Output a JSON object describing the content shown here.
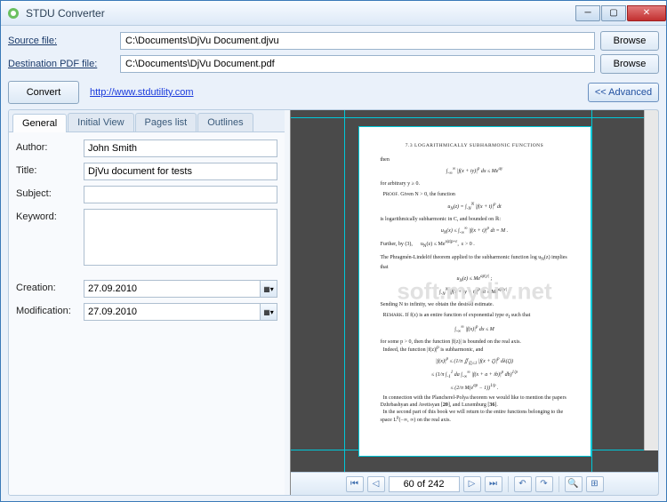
{
  "window": {
    "title": "STDU Converter"
  },
  "files": {
    "source_label": "Source file:",
    "source_value": "C:\\Documents\\DjVu Document.djvu",
    "dest_label": "Destination PDF file:",
    "dest_value": "C:\\Documents\\DjVu Document.pdf",
    "browse_label": "Browse"
  },
  "actions": {
    "convert_label": "Convert",
    "url": "http://www.stdutility.com",
    "advanced_label": "<< Advanced"
  },
  "tabs": {
    "general": "General",
    "initial": "Initial View",
    "pages": "Pages list",
    "outlines": "Outlines"
  },
  "fields": {
    "author_label": "Author:",
    "author_value": "John Smith",
    "title_label": "Title:",
    "title_value": "DjVu document for tests",
    "subject_label": "Subject:",
    "subject_value": "",
    "keyword_label": "Keyword:",
    "keyword_value": "",
    "creation_label": "Creation:",
    "creation_value": "27.09.2010",
    "modification_label": "Modification:",
    "modification_value": "27.09.2010"
  },
  "preview": {
    "watermark": "soft.mydiv.net",
    "page_display": "60 of 242",
    "doc_header": "7.3  LOGARITHMICALLY SUBHARMONIC FUNCTIONS"
  }
}
